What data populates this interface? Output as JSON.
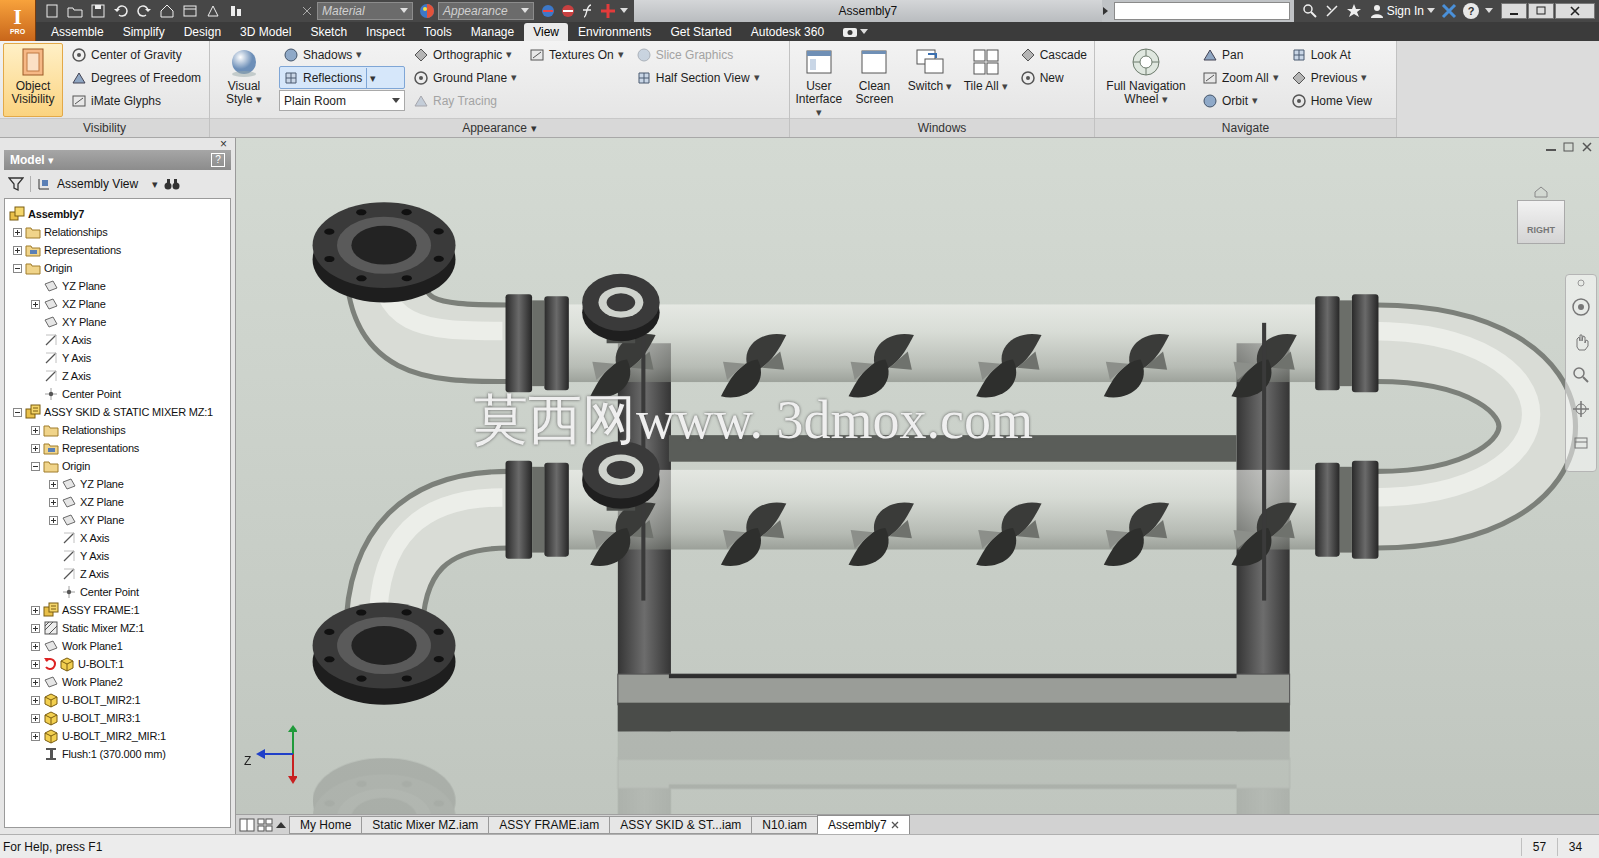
{
  "window": {
    "title": "Assembly7"
  },
  "app": {
    "logo": "I",
    "edition": "PRO"
  },
  "quick_access": {
    "material": "Material",
    "appearance": "Appearance"
  },
  "account": {
    "sign_in": "Sign In",
    "help": "?"
  },
  "ribbon_tabs": [
    {
      "label": "Assemble",
      "selected": false
    },
    {
      "label": "Simplify",
      "selected": false
    },
    {
      "label": "Design",
      "selected": false
    },
    {
      "label": "3D Model",
      "selected": false
    },
    {
      "label": "Sketch",
      "selected": false
    },
    {
      "label": "Inspect",
      "selected": false
    },
    {
      "label": "Tools",
      "selected": false
    },
    {
      "label": "Manage",
      "selected": false
    },
    {
      "label": "View",
      "selected": true
    },
    {
      "label": "Environments",
      "selected": false
    },
    {
      "label": "Get Started",
      "selected": false
    },
    {
      "label": "Autodesk 360",
      "selected": false
    }
  ],
  "visibility_panel": {
    "title": "Visibility",
    "large": {
      "label": "Object Visibility",
      "selected": true
    },
    "small": [
      {
        "label": "Center of Gravity",
        "selected": false,
        "disabled": false
      },
      {
        "label": "Degrees of Freedom",
        "selected": false,
        "disabled": false
      },
      {
        "label": "iMate Glyphs",
        "selected": false,
        "disabled": false
      }
    ]
  },
  "appearance_panel": {
    "title": "Appearance",
    "title_caret": "▾",
    "visual_style": {
      "label": "Visual Style",
      "caret": "▾",
      "selected": false
    },
    "columns": [
      [
        {
          "kind": "button",
          "label": "Shadows",
          "caret": "▾",
          "selected": false,
          "disabled": false
        },
        {
          "kind": "button",
          "label": "Reflections",
          "caret": "▾",
          "selected": true,
          "disabled": false
        },
        {
          "kind": "dropdown",
          "value": "Plain Room",
          "selected": false,
          "disabled": false
        }
      ],
      [
        {
          "kind": "button",
          "label": "Orthographic",
          "caret": "▾",
          "selected": false,
          "disabled": false
        },
        {
          "kind": "button",
          "label": "Ground Plane",
          "caret": "▾",
          "selected": false,
          "disabled": false
        },
        {
          "kind": "button",
          "label": "Ray Tracing",
          "selected": false,
          "disabled": true
        }
      ],
      [
        {
          "kind": "button",
          "label": "Textures On",
          "caret": "▾",
          "selected": false,
          "disabled": false
        }
      ],
      [
        {
          "kind": "button",
          "label": "Slice Graphics",
          "selected": false,
          "disabled": true
        },
        {
          "kind": "button",
          "label": "Half Section View",
          "caret": "▾",
          "selected": false,
          "disabled": false
        }
      ]
    ]
  },
  "windows_panel": {
    "title": "Windows",
    "large": [
      {
        "label": "User Interface",
        "caret": "▾",
        "selected": false
      },
      {
        "label": "Clean Screen",
        "selected": false
      },
      {
        "label": "Switch",
        "caret": "▾",
        "selected": false
      },
      {
        "label": "Tile All",
        "caret": "▾",
        "selected": false
      }
    ],
    "small": [
      {
        "label": "Cascade",
        "selected": false,
        "disabled": false
      },
      {
        "label": "New",
        "selected": false,
        "disabled": false
      }
    ]
  },
  "navigate_panel": {
    "title": "Navigate",
    "large": {
      "label": "Full Navigation Wheel",
      "caret": "▾",
      "selected": false
    },
    "columns": [
      [
        {
          "label": "Pan",
          "selected": false,
          "disabled": false
        },
        {
          "label": "Zoom All",
          "caret": "▾",
          "selected": false,
          "disabled": false
        },
        {
          "label": "Orbit",
          "caret": "▾",
          "selected": false,
          "disabled": false
        }
      ],
      [
        {
          "label": "Look At",
          "selected": false,
          "disabled": false
        },
        {
          "label": "Previous",
          "caret": "▾",
          "selected": false,
          "disabled": false
        },
        {
          "label": "Home View",
          "selected": false,
          "disabled": false
        }
      ]
    ]
  },
  "browser": {
    "close": "×",
    "title": "Model",
    "title_caret": "▾",
    "help": "?",
    "view": "Assembly View",
    "view_caret": "▾",
    "items": [
      {
        "label": "Assembly7",
        "level": 0,
        "kind": "assembly",
        "expandable": false,
        "expanded": true
      },
      {
        "label": "Relationships",
        "level": 1,
        "kind": "folder",
        "expandable": true,
        "expanded": false
      },
      {
        "label": "Representations",
        "level": 1,
        "kind": "representations",
        "expandable": true,
        "expanded": false
      },
      {
        "label": "Origin",
        "level": 1,
        "kind": "folder",
        "expandable": true,
        "expanded": true
      },
      {
        "label": "YZ Plane",
        "level": 2,
        "kind": "plane",
        "expandable": false,
        "expanded": false
      },
      {
        "label": "XZ Plane",
        "level": 2,
        "kind": "plane",
        "expandable": true,
        "expanded": false
      },
      {
        "label": "XY Plane",
        "level": 2,
        "kind": "plane",
        "expandable": false,
        "expanded": false
      },
      {
        "label": "X Axis",
        "level": 2,
        "kind": "axis",
        "expandable": false,
        "expanded": false
      },
      {
        "label": "Y Axis",
        "level": 2,
        "kind": "axis",
        "expandable": false,
        "expanded": false
      },
      {
        "label": "Z Axis",
        "level": 2,
        "kind": "axis",
        "expandable": false,
        "expanded": false
      },
      {
        "label": "Center Point",
        "level": 2,
        "kind": "point",
        "expandable": false,
        "expanded": false
      },
      {
        "label": "ASSY SKID & STATIC MIXER MZ:1",
        "level": 1,
        "kind": "subassembly",
        "expandable": true,
        "expanded": true
      },
      {
        "label": "Relationships",
        "level": 2,
        "kind": "folder",
        "expandable": true,
        "expanded": false
      },
      {
        "label": "Representations",
        "level": 2,
        "kind": "representations",
        "expandable": true,
        "expanded": false
      },
      {
        "label": "Origin",
        "level": 2,
        "kind": "folder",
        "expandable": true,
        "expanded": true
      },
      {
        "label": "YZ Plane",
        "level": 3,
        "kind": "plane",
        "expandable": true,
        "expanded": false
      },
      {
        "label": "XZ Plane",
        "level": 3,
        "kind": "plane",
        "expandable": true,
        "expanded": false
      },
      {
        "label": "XY Plane",
        "level": 3,
        "kind": "plane",
        "expandable": true,
        "expanded": false
      },
      {
        "label": "X Axis",
        "level": 3,
        "kind": "axis",
        "expandable": false,
        "expanded": false
      },
      {
        "label": "Y Axis",
        "level": 3,
        "kind": "axis",
        "expandable": false,
        "expanded": false
      },
      {
        "label": "Z Axis",
        "level": 3,
        "kind": "axis",
        "expandable": false,
        "expanded": false
      },
      {
        "label": "Center Point",
        "level": 3,
        "kind": "point",
        "expandable": false,
        "expanded": false
      },
      {
        "label": "ASSY FRAME:1",
        "level": 2,
        "kind": "subassembly",
        "expandable": true,
        "expanded": false
      },
      {
        "label": "Static Mixer MZ:1",
        "level": 2,
        "kind": "mixer",
        "expandable": true,
        "expanded": false
      },
      {
        "label": "Work Plane1",
        "level": 2,
        "kind": "plane",
        "expandable": true,
        "expanded": false
      },
      {
        "label": "U-BOLT:1",
        "level": 2,
        "kind": "adaptive_component",
        "expandable": true,
        "expanded": false
      },
      {
        "label": "Work Plane2",
        "level": 2,
        "kind": "plane",
        "expandable": true,
        "expanded": false
      },
      {
        "label": "U-BOLT_MIR2:1",
        "level": 2,
        "kind": "component",
        "expandable": true,
        "expanded": false
      },
      {
        "label": "U-BOLT_MIR3:1",
        "level": 2,
        "kind": "component",
        "expandable": true,
        "expanded": false
      },
      {
        "label": "U-BOLT_MIR2_MIR:1",
        "level": 2,
        "kind": "component",
        "expandable": true,
        "expanded": false
      },
      {
        "label": "Flush:1 (370.000 mm)",
        "level": 2,
        "kind": "constraint",
        "expandable": false,
        "expanded": false
      }
    ]
  },
  "viewport": {
    "view_cube": "RIGHT",
    "axis_label": "Z",
    "watermark": "莫西网www. 3dmox.com"
  },
  "document_tabs": [
    {
      "label": "My Home",
      "selected": false
    },
    {
      "label": "Static Mixer MZ.iam",
      "selected": false
    },
    {
      "label": "ASSY FRAME.iam",
      "selected": false
    },
    {
      "label": "ASSY SKID & ST...iam",
      "selected": false
    },
    {
      "label": "N10.iam",
      "selected": false
    },
    {
      "label": "Assembly7",
      "selected": true
    }
  ],
  "status_bar": {
    "help": "For Help, press F1",
    "counts": [
      "57",
      "34"
    ]
  }
}
